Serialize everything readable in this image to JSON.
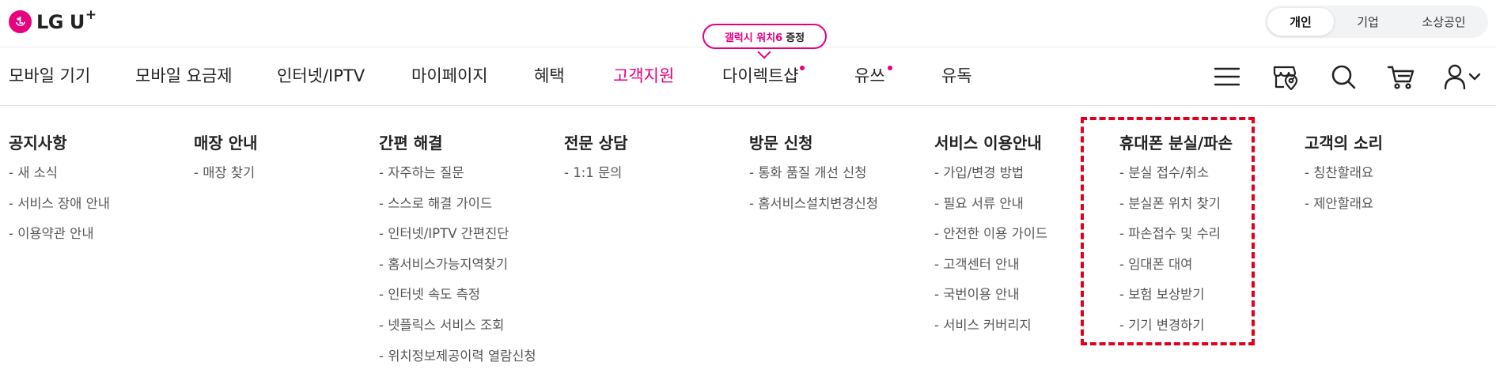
{
  "brand": {
    "logo_text": "LG U",
    "logo_plus": "+",
    "accent_color": "#e6007e"
  },
  "segment": {
    "items": [
      "개인",
      "기업",
      "소상공인"
    ],
    "active": "개인"
  },
  "promo_bubble": {
    "text_pink": "갤럭시 워치6",
    "text_dark": "증정"
  },
  "gnb": {
    "items": [
      "모바일 기기",
      "모바일 요금제",
      "인터넷/IPTV",
      "마이페이지",
      "혜택",
      "고객지원",
      "다이렉트샵",
      "유쓰",
      "유독"
    ],
    "active": "고객지원",
    "dotted": [
      "다이렉트샵",
      "유쓰"
    ]
  },
  "utility_icons": [
    "menu-icon",
    "store-map-icon",
    "search-icon",
    "cart-icon",
    "user-icon",
    "chevron-down-icon"
  ],
  "mega_menu": {
    "columns": [
      {
        "title": "공지사항",
        "items": [
          "새 소식",
          "서비스 장애 안내",
          "이용약관 안내"
        ]
      },
      {
        "title": "매장 안내",
        "items": [
          "매장 찾기"
        ]
      },
      {
        "title": "간편 해결",
        "items": [
          "자주하는 질문",
          "스스로 해결 가이드",
          "인터넷/IPTV 간편진단",
          "홈서비스가능지역찾기",
          "인터넷 속도 측정",
          "넷플릭스 서비스 조회",
          "위치정보제공이력 열람신청"
        ]
      },
      {
        "title": "전문 상담",
        "items": [
          "1:1 문의"
        ]
      },
      {
        "title": "방문 신청",
        "items": [
          "통화 품질 개선 신청",
          "홈서비스설치변경신청"
        ]
      },
      {
        "title": "서비스 이용안내",
        "items": [
          "가입/변경 방법",
          "필요 서류 안내",
          "안전한 이용 가이드",
          "고객센터 안내",
          "국번이용 안내",
          "서비스 커버리지"
        ]
      },
      {
        "title": "휴대폰 분실/파손",
        "items": [
          "분실 접수/취소",
          "분실폰 위치 찾기",
          "파손접수 및 수리",
          "임대폰 대여",
          "보험 보상받기",
          "기기 변경하기"
        ]
      },
      {
        "title": "고객의 소리",
        "items": [
          "칭찬할래요",
          "제안할래요"
        ]
      }
    ]
  }
}
